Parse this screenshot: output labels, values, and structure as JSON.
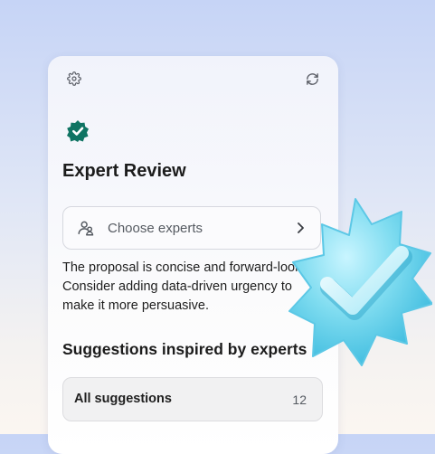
{
  "header": {
    "settings_icon": "gear-icon",
    "refresh_icon": "refresh-icon"
  },
  "badge": {
    "icon": "verified-badge-icon",
    "color": "#0f7463"
  },
  "title": "Expert Review",
  "experts_picker": {
    "icon": "people-icon",
    "label": "Choose experts",
    "chevron_icon": "chevron-right-icon"
  },
  "summary": "The proposal is concise and forward-looking. Consider adding data-driven urgency to make it more persuasive.",
  "suggestions": {
    "heading": "Suggestions inspired by experts",
    "all_label": "All suggestions",
    "count": "12"
  },
  "decoration": {
    "icon": "checkmark-sticker-icon",
    "color": "#7fdcf0"
  }
}
